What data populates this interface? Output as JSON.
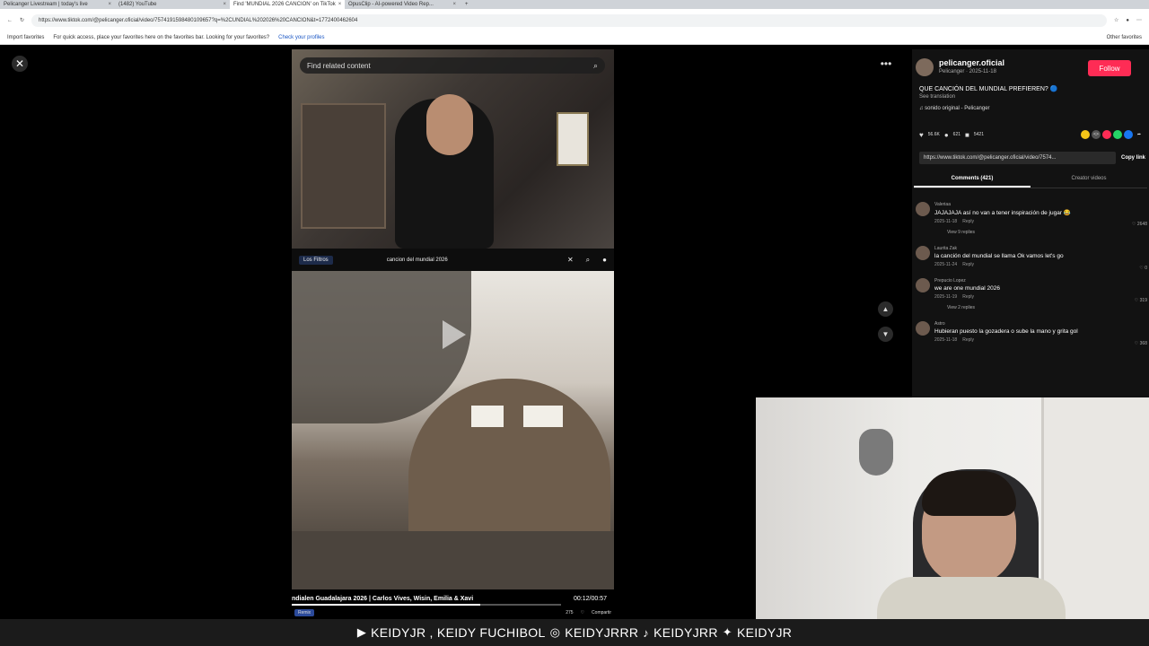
{
  "browser": {
    "tabs": [
      {
        "label": "Pelicanger Livestream | today's live",
        "active": false
      },
      {
        "label": "(1482) YouTube",
        "active": false
      },
      {
        "label": "Find 'MUNDIAL 2026 CANCION' on TikTok",
        "active": true
      },
      {
        "label": "OpusClip - AI-powered Video Rep...",
        "active": false
      }
    ],
    "new_tab": "+",
    "url": "https://www.tiktok.com/@pelicanger.oficial/video/7574191598480109657?q=%2CUNDIAL%202026%20CANCION&t=1772400462604",
    "favorites": {
      "import": "Import favorites",
      "hint": "For quick access, place your favorites here on the favorites bar. Looking for your favorites?",
      "link": "Check your profiles",
      "other": "Other favorites"
    }
  },
  "viewer": {
    "close": "✕",
    "search_placeholder": "Find related content",
    "filters_label": "Los Filtros",
    "query": "cancion del mundial 2026",
    "caption": "ndialen Guadalajara 2026 | Carlos Vives, Wisin, Emilia & Xavi",
    "time": "00:12/00:57",
    "remix": "Remix",
    "likes": "275",
    "share": "Compartir",
    "more": "•••",
    "nav_up": "▲",
    "nav_down": "▼"
  },
  "panel": {
    "username": "pelicanger.oficial",
    "subline": "Pelicanger · 2025-11-18",
    "follow": "Follow",
    "title": "QUE CANCIÓN DEL MUNDIAL PREFIEREN? 🔵",
    "see_translation": "See translation",
    "sound": "sonido original - Pelicanger",
    "likes": "56.6K",
    "comments": "621",
    "saves": "5421",
    "link": "https://www.tiktok.com/@pelicanger.oficial/video/7574...",
    "copy": "Copy link",
    "tabs": [
      "Comments (421)",
      "Creator videos"
    ],
    "comment_list": [
      {
        "user": "Valeriaa",
        "text": "JAJAJAJA así no van a tener inspiración de jugar 😂",
        "date": "2025-11-18",
        "reply": "Reply",
        "likes": "2648",
        "replies": "View 9 replies"
      },
      {
        "user": "Laurita Zak",
        "text": "la canción del mundial se llama Ok vamos let's go",
        "date": "2025-11-24",
        "reply": "Reply",
        "likes": "0",
        "replies": ""
      },
      {
        "user": "Prepucio Lopez",
        "text": "we are one mundial 2026",
        "date": "2025-11-19",
        "reply": "Reply",
        "likes": "319",
        "replies": "View 2 replies"
      },
      {
        "user": "Astro",
        "text": "Hubieran puesto la gozadera o sube la mano y grita gol",
        "date": "2025-11-18",
        "reply": "Reply",
        "likes": "368",
        "replies": ""
      }
    ]
  },
  "ticker": {
    "yt": "KEIDYJR , KEIDY FUCHIBOL",
    "ig": "KEIDYJRRR",
    "tt": "KEIDYJRR",
    "tw": "KEIDYJR"
  },
  "colors": {
    "follow": "#fe2c55",
    "bg": "#000000",
    "panel": "#121212"
  }
}
